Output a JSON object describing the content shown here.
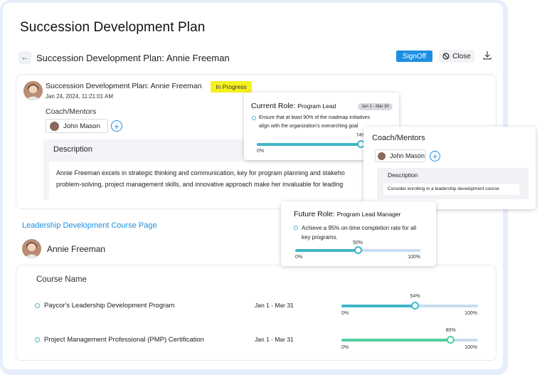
{
  "page": {
    "title": "Succession Development Plan"
  },
  "header": {
    "subtitle": "Succession Development Plan: Annie Freeman",
    "signoff_label": "SignOff",
    "close_label": "Close"
  },
  "plan_card": {
    "name": "Succession Development Plan: Annie Freeman",
    "date": "Jan 24, 2024, 11:21:01 AM",
    "status": "In Progress",
    "coach_label": "Coach/Mentors",
    "coach_name": "John Mason",
    "description_title": "Description",
    "description_line1": "Annie Freeman excels in strategic thinking and communication, key for program planning and stakeho",
    "description_line2": "problem-solving, project management skills, and innovative approach make her invaluable for leading"
  },
  "current_role_popup": {
    "title": "Current Role:",
    "role": "Program Lead",
    "date_range": "Jan 1 - Mar 30",
    "goal_line1": "Ensure that at least 90% of the roadmap initiatives",
    "goal_line2": "align with the organization's overarching goal",
    "progress": 74,
    "progress_label": "74%",
    "min_label": "0%"
  },
  "coach_popup": {
    "title": "Coach/Mentors",
    "coach_name": "John Mason",
    "description_title": "Description",
    "description_text": "Consider enrolling in a leadership development course"
  },
  "future_role_popup": {
    "title": "Future Role:",
    "role": "Program Lead Manager",
    "goal_line1": "Achieve a 95% on-time completion rate for all",
    "goal_line2": "key programs.",
    "progress": 50,
    "progress_label": "50%",
    "min_label": "0%",
    "max_label": "100%"
  },
  "ldc": {
    "link_label": "Leadership Development Course Page",
    "person_name": "Annie Freeman",
    "column_header": "Course Name",
    "courses": [
      {
        "name": "Paycor's Leadership Development Program",
        "date": "Jan 1 - Mar 31",
        "progress": 54,
        "progress_label": "54%",
        "min_label": "0%",
        "max_label": "100%",
        "fill_color": "#3fb6c7"
      },
      {
        "name": "Project Management Professional (PMP) Certification",
        "date": "Jan 1 - Mar 31",
        "progress": 80,
        "progress_label": "80%",
        "min_label": "0%",
        "max_label": "100%",
        "fill_color": "#4fcf9e"
      }
    ]
  },
  "colors": {
    "accent": "#1d8fe1",
    "status_in_progress": "#f4f11d",
    "slider_fill": "#3fb6c7"
  }
}
